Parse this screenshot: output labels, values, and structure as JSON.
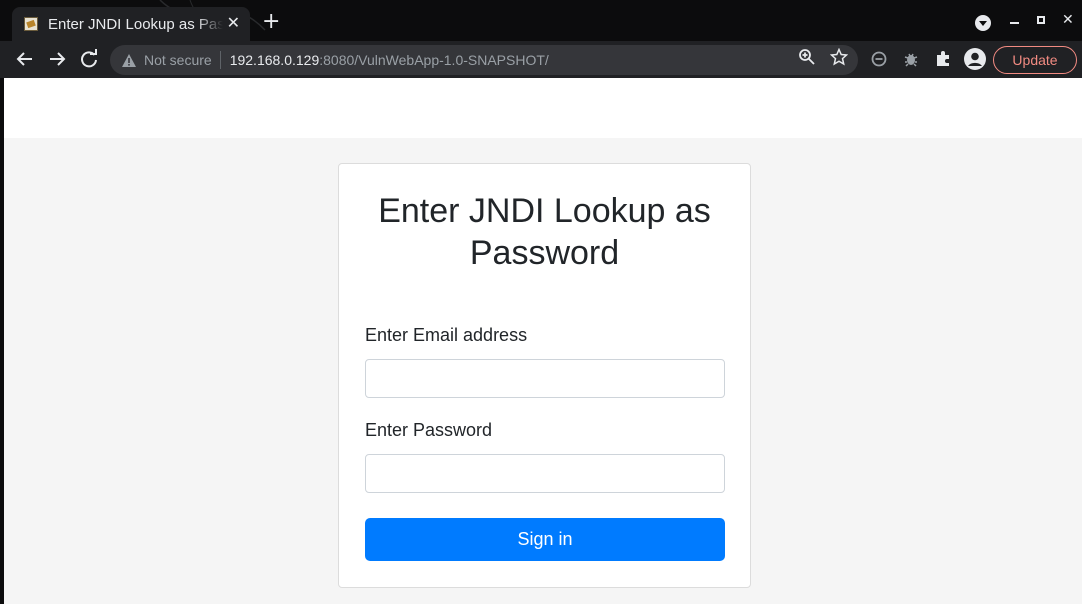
{
  "browser": {
    "tab_title": "Enter JNDI Lookup as Password",
    "tab_close": "✕",
    "new_tab": "+",
    "security_label": "Not secure",
    "url_host": "192.168.0.129",
    "url_rest": ":8080/VulnWebApp-1.0-SNAPSHOT/",
    "update_label": "Update",
    "window_close": "✕"
  },
  "icons": {
    "back": "back-arrow-icon",
    "forward": "forward-arrow-icon",
    "reload": "reload-icon",
    "warning": "warning-triangle-icon",
    "zoom": "zoom-icon",
    "bookmark": "star-icon",
    "minus": "minus-circle-icon",
    "extension_a": "bug-extension-icon",
    "extensions": "puzzle-icon",
    "profile": "profile-avatar-icon"
  },
  "colors": {
    "primary_button": "#007bff",
    "update_accent": "#f28b82"
  },
  "form": {
    "heading": "Enter JNDI Lookup as Password",
    "email_label": "Enter Email address",
    "email_value": "",
    "password_label": "Enter Password",
    "password_value": "",
    "submit_label": "Sign in"
  }
}
